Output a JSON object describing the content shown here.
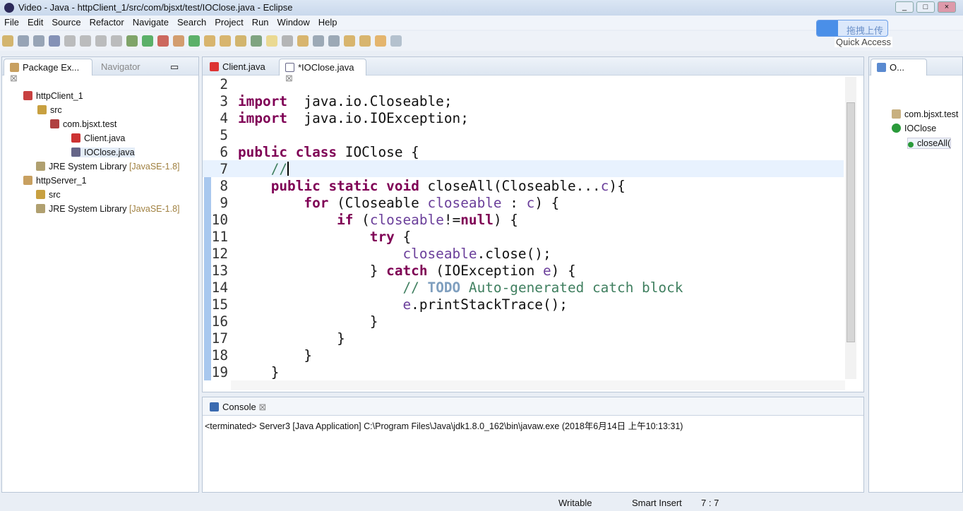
{
  "window": {
    "title": "Video - Java - httpClient_1/src/com/bjsxt/test/IOClose.java - Eclipse"
  },
  "menu": [
    "File",
    "Edit",
    "Source",
    "Refactor",
    "Navigate",
    "Search",
    "Project",
    "Run",
    "Window",
    "Help"
  ],
  "upload_badge": "拖拽上传",
  "quick_access": "Quick Access",
  "left_panel": {
    "tabs": [
      "Package Ex...",
      "Navigator"
    ],
    "tree": [
      {
        "label": "httpClient_1"
      },
      {
        "label": "src"
      },
      {
        "label": "com.bjsxt.test"
      },
      {
        "label": "Client.java"
      },
      {
        "label": "IOClose.java"
      },
      {
        "label": "JRE System Library",
        "suffix": "[JavaSE-1.8]"
      },
      {
        "label": "httpServer_1"
      },
      {
        "label": "src"
      },
      {
        "label": "JRE System Library",
        "suffix": "[JavaSE-1.8]"
      }
    ]
  },
  "editor": {
    "tabs": [
      "Client.java",
      "*IOClose.java"
    ],
    "lines": [
      {
        "n": "2",
        "t": []
      },
      {
        "n": "3",
        "t": [
          [
            "kw",
            "import"
          ],
          [
            "",
            "  java.io.Closeable;"
          ]
        ]
      },
      {
        "n": "4",
        "t": [
          [
            "kw",
            "import"
          ],
          [
            "",
            "  java.io.IOException;"
          ]
        ]
      },
      {
        "n": "5",
        "t": []
      },
      {
        "n": "6",
        "t": [
          [
            "kw",
            "public"
          ],
          [
            "",
            " "
          ],
          [
            "kw",
            "class"
          ],
          [
            "",
            " IOClose {"
          ]
        ]
      },
      {
        "n": "7",
        "t": [
          [
            "",
            "    "
          ],
          [
            "cm",
            "//"
          ]
        ]
      },
      {
        "n": "8",
        "t": [
          [
            "",
            "    "
          ],
          [
            "kw",
            "public"
          ],
          [
            "",
            " "
          ],
          [
            "kw",
            "static"
          ],
          [
            "",
            " "
          ],
          [
            "kw",
            "void"
          ],
          [
            "",
            " closeAll(Closeable..."
          ],
          [
            "vr",
            "c"
          ],
          [
            "",
            "){"
          ]
        ]
      },
      {
        "n": "9",
        "t": [
          [
            "",
            "        "
          ],
          [
            "kw",
            "for"
          ],
          [
            "",
            " (Closeable "
          ],
          [
            "vr",
            "closeable"
          ],
          [
            "",
            " : "
          ],
          [
            "vr",
            "c"
          ],
          [
            "",
            ") {"
          ]
        ]
      },
      {
        "n": "10",
        "t": [
          [
            "",
            "            "
          ],
          [
            "kw",
            "if"
          ],
          [
            "",
            " ("
          ],
          [
            "vr",
            "closeable"
          ],
          [
            "",
            "!="
          ],
          [
            "kw",
            "null"
          ],
          [
            "",
            ") {"
          ]
        ]
      },
      {
        "n": "11",
        "t": [
          [
            "",
            "                "
          ],
          [
            "kw",
            "try"
          ],
          [
            "",
            " {"
          ]
        ]
      },
      {
        "n": "12",
        "t": [
          [
            "",
            "                    "
          ],
          [
            "vr",
            "closeable"
          ],
          [
            "",
            ".close();"
          ]
        ]
      },
      {
        "n": "13",
        "t": [
          [
            "",
            "                } "
          ],
          [
            "kw",
            "catch"
          ],
          [
            "",
            " (IOException "
          ],
          [
            "vr",
            "e"
          ],
          [
            "",
            ") {"
          ]
        ]
      },
      {
        "n": "14",
        "t": [
          [
            "",
            "                    "
          ],
          [
            "cm",
            "// "
          ],
          [
            "todo",
            "TODO"
          ],
          [
            "cm",
            " Auto-generated catch block"
          ]
        ]
      },
      {
        "n": "15",
        "t": [
          [
            "",
            "                    "
          ],
          [
            "vr",
            "e"
          ],
          [
            "",
            ".printStackTrace();"
          ]
        ]
      },
      {
        "n": "16",
        "t": [
          [
            "",
            "                }"
          ]
        ]
      },
      {
        "n": "17",
        "t": [
          [
            "",
            "            }"
          ]
        ]
      },
      {
        "n": "18",
        "t": [
          [
            "",
            "        }"
          ]
        ]
      },
      {
        "n": "19",
        "t": [
          [
            "",
            "    }"
          ]
        ]
      }
    ]
  },
  "console": {
    "tab": "Console",
    "status": "<terminated> Server3 [Java Application] C:\\Program Files\\Java\\jdk1.8.0_162\\bin\\javaw.exe (2018年6月14日 上午10:13:31)"
  },
  "outline": {
    "tab": "O...",
    "items": [
      "com.bjsxt.test",
      "IOClose",
      "closeAll("
    ]
  },
  "statusbar": {
    "writable": "Writable",
    "insert": "Smart Insert",
    "position": "7 : 7"
  }
}
